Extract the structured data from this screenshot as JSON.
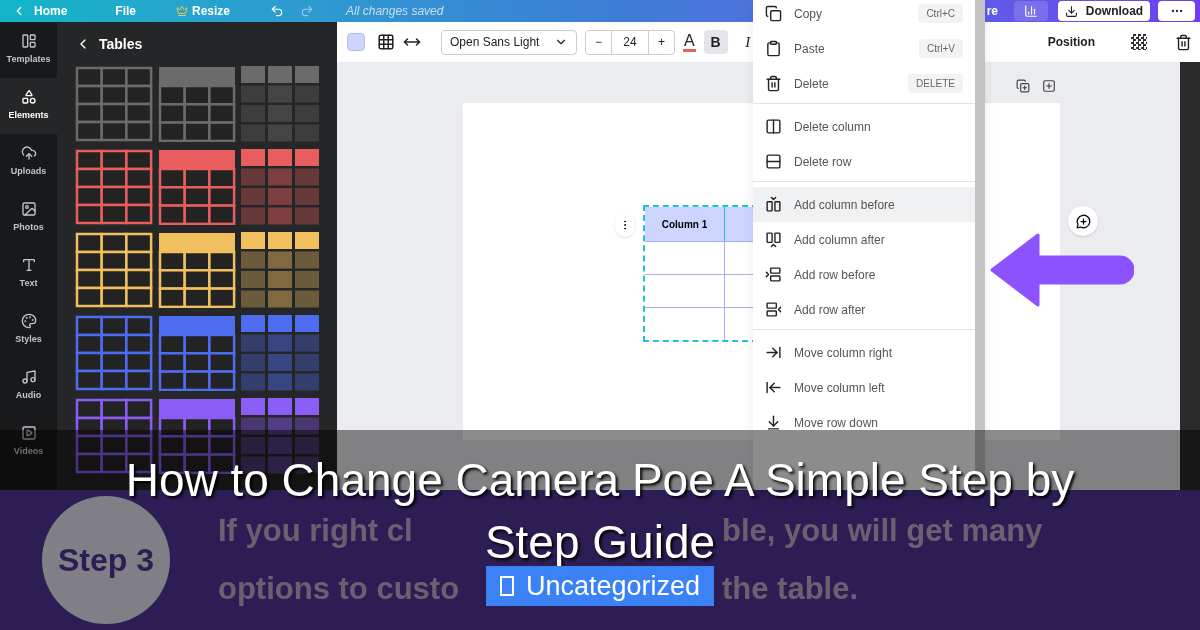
{
  "top_bar": {
    "back": "Home",
    "file": "File",
    "resize": "Resize",
    "status": "All changes saved",
    "share_fragment": "re",
    "download": "Download"
  },
  "rail": [
    {
      "label": "Templates",
      "selected": false
    },
    {
      "label": "Elements",
      "selected": true
    },
    {
      "label": "Uploads",
      "selected": false
    },
    {
      "label": "Photos",
      "selected": false
    },
    {
      "label": "Text",
      "selected": false
    },
    {
      "label": "Styles",
      "selected": false
    },
    {
      "label": "Audio",
      "selected": false
    },
    {
      "label": "Videos",
      "selected": false
    }
  ],
  "panel": {
    "title": "Tables",
    "presets": [
      {
        "color": "#6b6b6b",
        "thumbnails": [
          {
            "kind": "grid"
          },
          {
            "kind": "header"
          },
          {
            "kind": "tiled"
          }
        ]
      },
      {
        "color": "#e85d5d",
        "thumbnails": [
          {
            "kind": "grid"
          },
          {
            "kind": "header"
          },
          {
            "kind": "tiled"
          }
        ]
      },
      {
        "color": "#f2bf5e",
        "thumbnails": [
          {
            "kind": "grid"
          },
          {
            "kind": "header"
          },
          {
            "kind": "tiled"
          }
        ]
      },
      {
        "color": "#4d6cf0",
        "thumbnails": [
          {
            "kind": "grid"
          },
          {
            "kind": "header"
          },
          {
            "kind": "tiled"
          }
        ]
      },
      {
        "color": "#8b5cf6",
        "thumbnails": [
          {
            "kind": "grid"
          },
          {
            "kind": "header"
          },
          {
            "kind": "tiled"
          }
        ]
      }
    ]
  },
  "toolbar": {
    "font": "Open Sans Light",
    "size": "24",
    "minus": "−",
    "plus": "+",
    "text_color": "A",
    "bold": {
      "label": "B",
      "selected": true
    },
    "italic": {
      "label": "I",
      "selected": false
    },
    "position": "Position"
  },
  "table": {
    "header": "Column 1"
  },
  "context_menu": {
    "groups": [
      {
        "items": [
          {
            "kind": "copy",
            "label": "Copy",
            "shortcut": "Ctrl+C",
            "selected": false
          },
          {
            "kind": "paste",
            "label": "Paste",
            "shortcut": "Ctrl+V",
            "selected": false
          },
          {
            "kind": "delete",
            "label": "Delete",
            "shortcut": "DELETE",
            "selected": false
          }
        ]
      },
      {
        "items": [
          {
            "kind": "delete-column",
            "label": "Delete column",
            "selected": false
          },
          {
            "kind": "delete-row",
            "label": "Delete row",
            "selected": false
          }
        ]
      },
      {
        "items": [
          {
            "kind": "add-column-before",
            "label": "Add column before",
            "selected": true
          },
          {
            "kind": "add-column-after",
            "label": "Add column after",
            "selected": false
          },
          {
            "kind": "add-row-before",
            "label": "Add row before",
            "selected": false
          },
          {
            "kind": "add-row-after",
            "label": "Add row after",
            "selected": false
          }
        ]
      },
      {
        "items": [
          {
            "kind": "move-column-right",
            "label": "Move column right",
            "selected": false
          },
          {
            "kind": "move-column-left",
            "label": "Move column left",
            "selected": false
          },
          {
            "kind": "move-row-down",
            "label": "Move row down",
            "selected": false
          }
        ]
      }
    ]
  },
  "slide": {
    "step": "Step 3",
    "line_1": [
      "If you right cl",
      "ble, you will get many"
    ],
    "line_2": [
      "options to custo",
      "the table."
    ]
  },
  "post": {
    "title_lines": [
      "How to Change Camera Poe A Simple Step by",
      "Step Guide"
    ],
    "category": "Uncategorized"
  }
}
